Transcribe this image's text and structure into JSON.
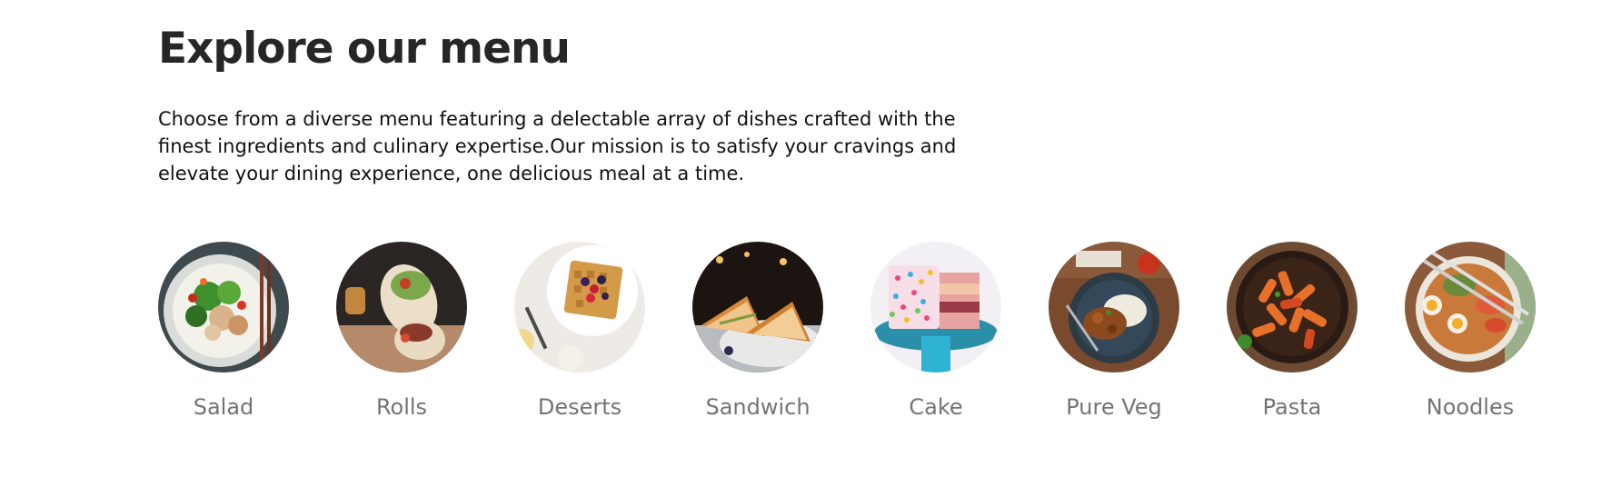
{
  "menu": {
    "title": "Explore our menu",
    "description": "Choose from a diverse menu featuring a delectable array of dishes crafted with the finest ingredients and culinary expertise.Our mission is to satisfy your cravings and elevate your dining experience, one delicious meal at a time."
  },
  "categories": [
    {
      "label": "Salad"
    },
    {
      "label": "Rolls"
    },
    {
      "label": "Deserts"
    },
    {
      "label": "Sandwich"
    },
    {
      "label": "Cake"
    },
    {
      "label": "Pure Veg"
    },
    {
      "label": "Pasta"
    },
    {
      "label": "Noodles"
    }
  ],
  "colors": {
    "heading": "#262626",
    "body_text": "#111111",
    "category_label": "#747474"
  }
}
